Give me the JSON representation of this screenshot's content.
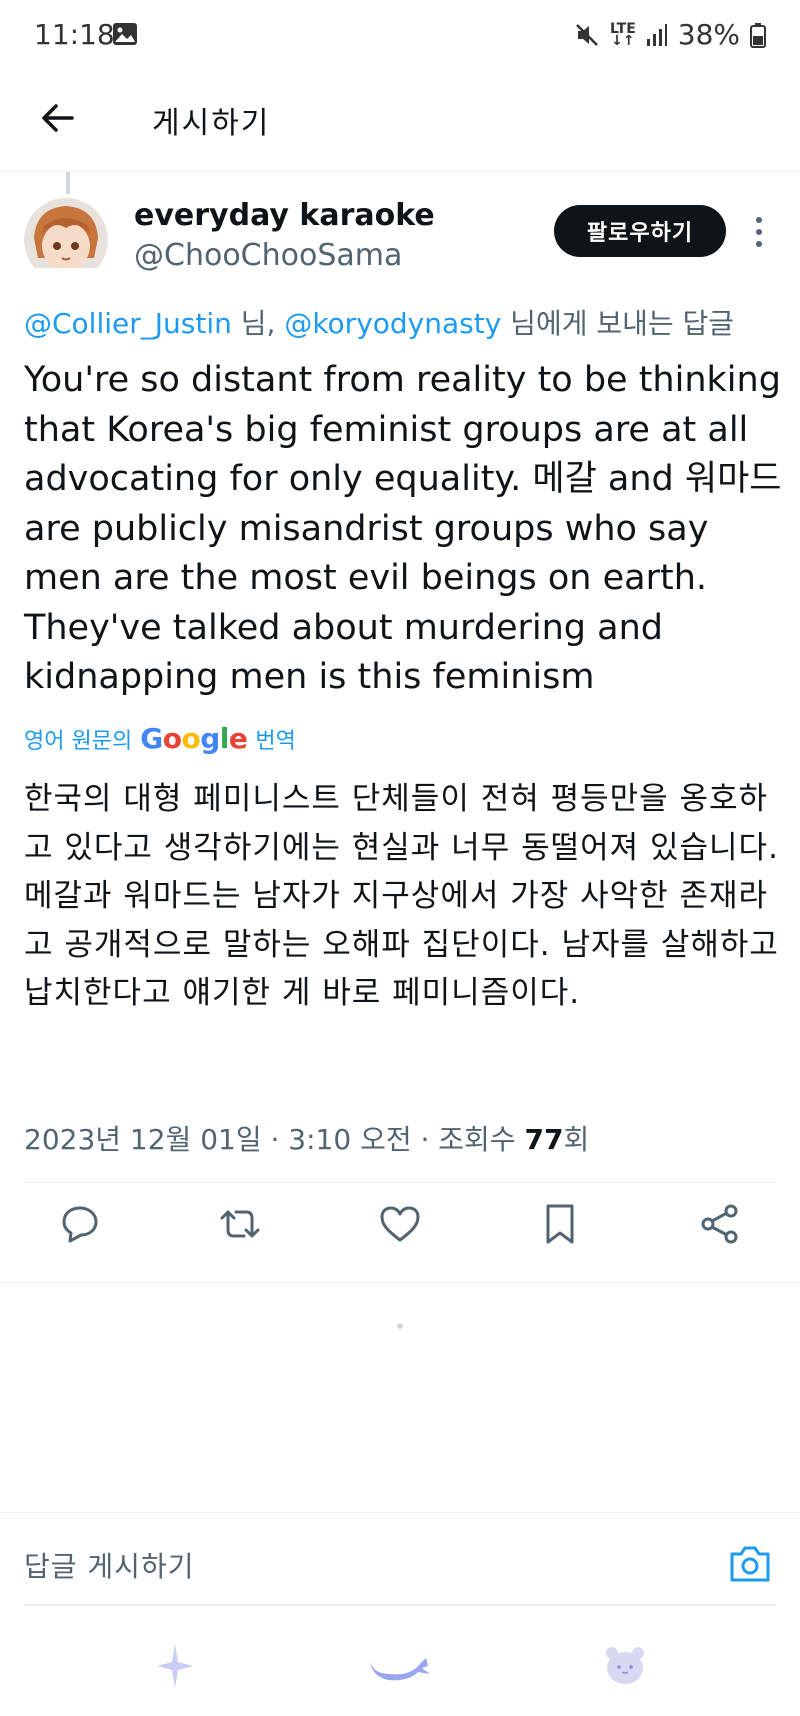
{
  "status_bar": {
    "time": "11:18",
    "lte_top": "LTE",
    "battery": "38%"
  },
  "app_bar": {
    "title": "게시하기"
  },
  "tweet": {
    "display_name": "everyday karaoke",
    "handle": "@ChooChooSama",
    "follow_label": "팔로우하기",
    "reply_to": {
      "mention_1": "@Collier_Justin",
      "separator": " 님, ",
      "mention_2": "@koryodynasty",
      "suffix": " 님에게 보내는 답글"
    },
    "text": "You're so distant from reality to be thinking that Korea's big feminist groups are at all advocating for only equality. 메갈 and 워마드 are publicly misandrist groups who say men are the most evil beings on earth. They've talked about murdering and kidnapping men is this feminism",
    "translation": {
      "label": "영어 원문의",
      "provider": "Google",
      "suffix": "번역",
      "text": "한국의 대형 페미니스트 단체들이 전혀 평등만을 옹호하고 있다고 생각하기에는 현실과 너무 동떨어져 있습니다. 메갈과 워마드는 남자가 지구상에서 가장 사악한 존재라고 공개적으로 말하는 오해파 집단이다. 남자를 살해하고 납치한다고 얘기한 게 바로 페미니즘이다."
    },
    "meta": {
      "timestamp": "2023년 12월 01일 · 3:10 오전 · 조회수 ",
      "views": "77",
      "views_suffix": "회"
    },
    "actions": [
      "reply-icon",
      "retweet-icon",
      "like-icon",
      "bookmark-icon",
      "share-icon"
    ]
  },
  "reply_box": {
    "placeholder": "답글 게시하기"
  },
  "bottom_nav": [
    "sparkle-icon",
    "whale-icon",
    "bear-icon"
  ],
  "colors": {
    "link": "#1d9bf0",
    "text": "#0f1419",
    "muted": "#536471",
    "follow_bg": "#0f1419"
  }
}
